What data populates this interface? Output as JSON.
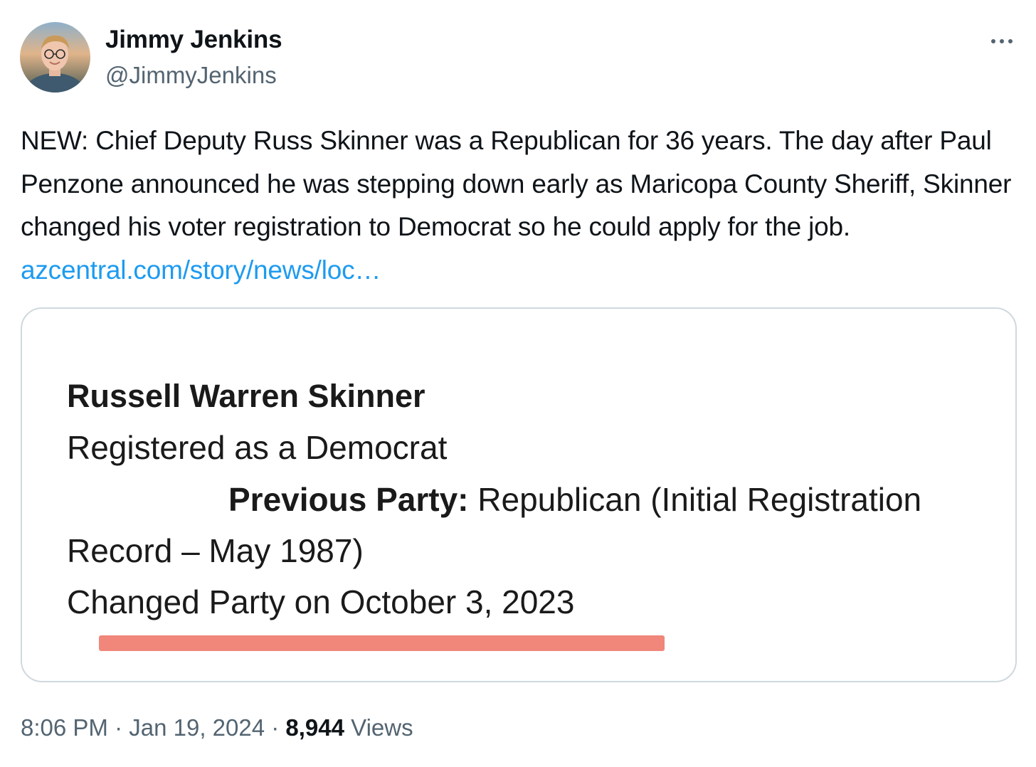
{
  "author": {
    "name": "Jimmy Jenkins",
    "handle": "@JimmyJenkins",
    "avatar_icon": "profile-photo"
  },
  "more_icon": "more-horizontal-icon",
  "tweet": {
    "text": "NEW: Chief Deputy Russ Skinner was a Republican for 36 years. The day after Paul Penzone announced he was stepping down early as Maricopa County Sheriff, Skinner changed his voter registration to Democrat so he could apply for the job. ",
    "link_text": "azcentral.com/story/news/loc…"
  },
  "media": {
    "name": "Russell Warren Skinner",
    "registered": "Registered as a Democrat",
    "previous_party_label": "Previous Party:",
    "previous_party_value": " Republican (Initial Registration",
    "record_line": "Record – May 1987)",
    "changed_line": "Changed Party on October 3, 2023",
    "highlight_color": "#ef7d6f"
  },
  "meta": {
    "time": "8:06 PM",
    "separator": " · ",
    "date": "Jan 19, 2024",
    "views_count": "8,944",
    "views_label": " Views"
  },
  "colors": {
    "text": "#0f1419",
    "secondary": "#536471",
    "link": "#1d9bf0",
    "border": "#cfd9de"
  }
}
